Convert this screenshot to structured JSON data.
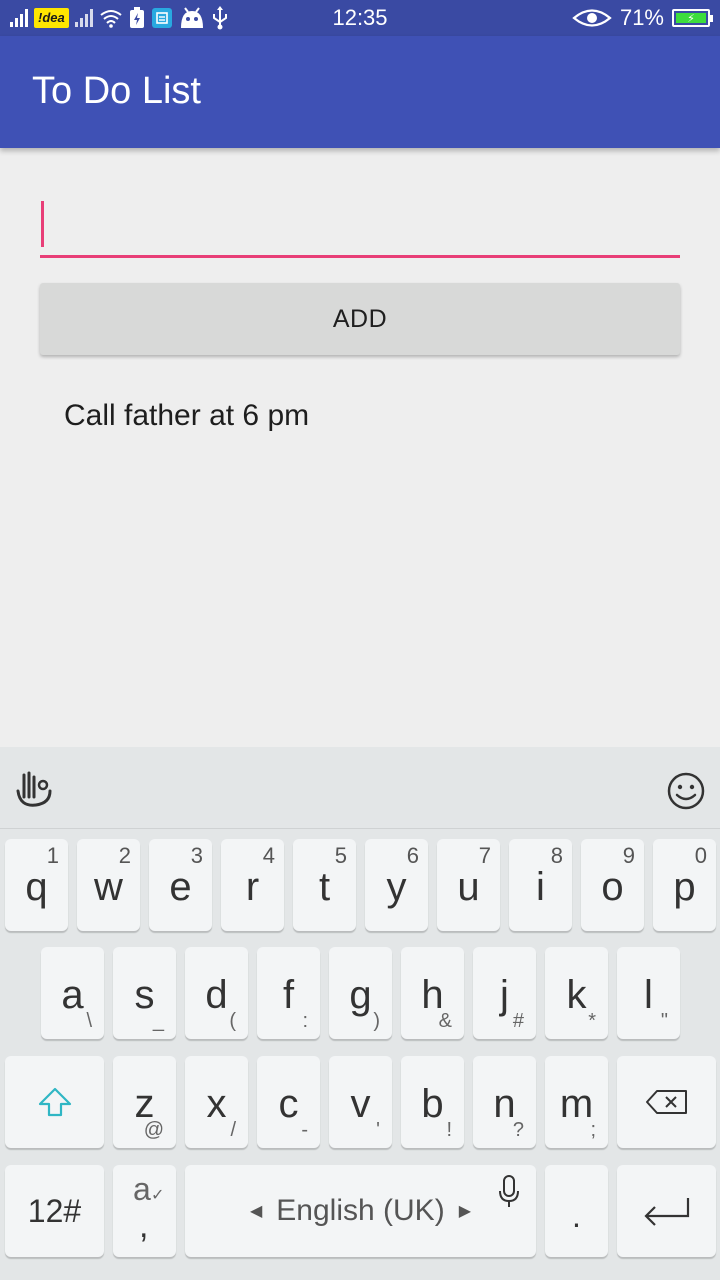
{
  "status_bar": {
    "carrier": "!dea",
    "time": "12:35",
    "battery_percent": "71%",
    "icons": [
      "signal-icon",
      "carrier-badge",
      "signal-icon",
      "wifi-icon",
      "battery-saver-icon",
      "notification-icon",
      "android-icon",
      "usb-icon",
      "eye-icon",
      "battery-charging-icon"
    ]
  },
  "app_bar": {
    "title": "To Do List"
  },
  "input": {
    "value": "",
    "placeholder": ""
  },
  "add_button": {
    "label": "ADD"
  },
  "tasks": [
    "Call father at 6 pm"
  ],
  "keyboard": {
    "row1": [
      {
        "main": "q",
        "num": "1"
      },
      {
        "main": "w",
        "num": "2"
      },
      {
        "main": "e",
        "num": "3"
      },
      {
        "main": "r",
        "num": "4"
      },
      {
        "main": "t",
        "num": "5"
      },
      {
        "main": "y",
        "num": "6"
      },
      {
        "main": "u",
        "num": "7"
      },
      {
        "main": "i",
        "num": "8"
      },
      {
        "main": "o",
        "num": "9"
      },
      {
        "main": "p",
        "num": "0"
      }
    ],
    "row2": [
      {
        "main": "a",
        "sub": "\\"
      },
      {
        "main": "s",
        "sub": "_"
      },
      {
        "main": "d",
        "sub": "("
      },
      {
        "main": "f",
        "sub": ":"
      },
      {
        "main": "g",
        "sub": ")"
      },
      {
        "main": "h",
        "sub": "&"
      },
      {
        "main": "j",
        "sub": "#"
      },
      {
        "main": "k",
        "sub": "*"
      },
      {
        "main": "l",
        "sub": "\""
      }
    ],
    "row3": [
      {
        "main": "z",
        "sub": "@"
      },
      {
        "main": "x",
        "sub": "/"
      },
      {
        "main": "c",
        "sub": "-"
      },
      {
        "main": "v",
        "sub": "'"
      },
      {
        "main": "b",
        "sub": "!"
      },
      {
        "main": "n",
        "sub": "?"
      },
      {
        "main": "m",
        "sub": ";"
      }
    ],
    "symbols_label": "12#",
    "accent_key": {
      "main": "a",
      "sub": ","
    },
    "space_label": "English (UK)",
    "period_label": "."
  },
  "colors": {
    "app_bar": "#3f51b5",
    "status_bar": "#3a4aa3",
    "accent": "#e83e77",
    "button": "#d8d9d8",
    "keyboard": "#e3e6e7"
  }
}
